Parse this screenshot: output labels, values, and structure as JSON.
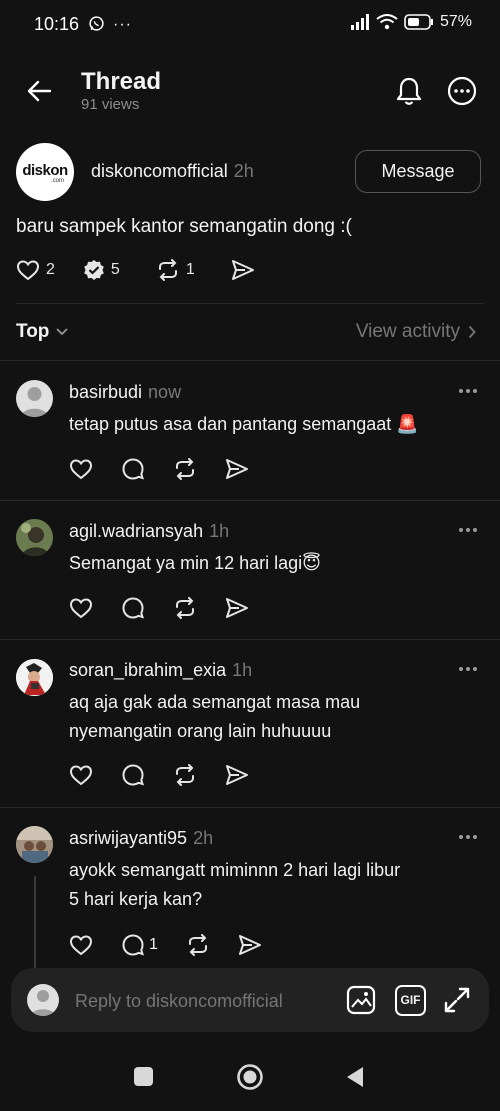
{
  "status_bar": {
    "time": "10:16",
    "battery": "57%"
  },
  "header": {
    "title": "Thread",
    "views": "91 views"
  },
  "post": {
    "avatar_text": "diskon",
    "avatar_sub": ".com",
    "username": "diskoncomofficial",
    "time": "2h",
    "message_button": "Message",
    "text": "baru sampek kantor semangatin dong :(",
    "likes": "2",
    "replies": "5",
    "reposts": "1"
  },
  "sort": {
    "label": "Top",
    "view_activity": "View activity"
  },
  "comments": [
    {
      "username": "basirbudi",
      "time": "now",
      "lines": [
        "tetap putus asa dan pantang semangaat 🚨"
      ],
      "reply_count": ""
    },
    {
      "username": "agil.wadriansyah",
      "time": "1h",
      "lines": [
        "Semangat ya min 12 hari lagi😇"
      ],
      "reply_count": ""
    },
    {
      "username": "soran_ibrahim_exia",
      "time": "1h",
      "lines": [
        "aq aja gak ada semangat masa mau",
        "nyemangatin orang lain huhuuuu"
      ],
      "reply_count": ""
    },
    {
      "username": "asriwijayanti95",
      "time": "2h",
      "lines": [
        "ayokk semangatt miminnn 2 hari lagi libur",
        "5 hari kerja kan?"
      ],
      "reply_count": "1"
    }
  ],
  "reply_bar": {
    "placeholder": "Reply to diskoncomofficial",
    "gif_label": "GIF"
  },
  "colors": {
    "background": "#121212",
    "surface": "#222222",
    "muted": "#777777",
    "brand_green": "#8cc63f"
  }
}
